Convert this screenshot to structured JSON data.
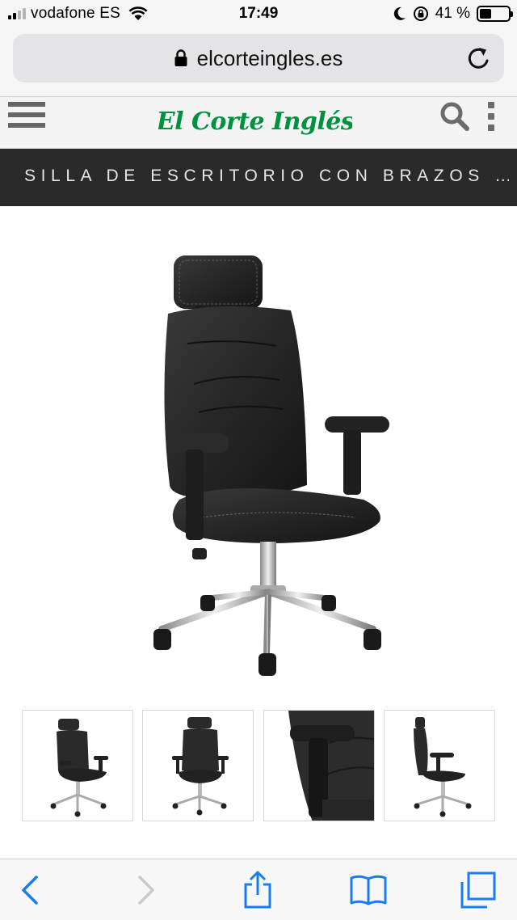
{
  "status_bar": {
    "carrier": "vodafone ES",
    "time": "17:49",
    "battery_percent": "41 %",
    "battery_level": 0.41,
    "signal_bars_active": 2,
    "icons": [
      "signal-icon",
      "wifi-icon",
      "moon-icon",
      "orientation-lock-icon",
      "battery-icon"
    ]
  },
  "browser": {
    "url": "elcorteingles.es",
    "icons": [
      "lock-icon",
      "reload-icon"
    ]
  },
  "site_header": {
    "logo_text": "El Corte Inglés",
    "icons": [
      "menu-icon",
      "search-icon",
      "more-vertical-icon"
    ],
    "brand_color": "#00913f"
  },
  "product": {
    "title": "SILLA DE ESCRITORIO CON BRAZOS …",
    "main_image": "office-chair-front-three-quarter",
    "thumbnails": [
      {
        "view": "three-quarter"
      },
      {
        "view": "front"
      },
      {
        "view": "armrest-detail"
      },
      {
        "view": "side"
      }
    ]
  },
  "toolbar": {
    "icons": [
      "back-icon",
      "forward-icon",
      "share-icon",
      "bookmarks-icon",
      "tabs-icon"
    ],
    "accent_color": "#1a7cf0"
  }
}
